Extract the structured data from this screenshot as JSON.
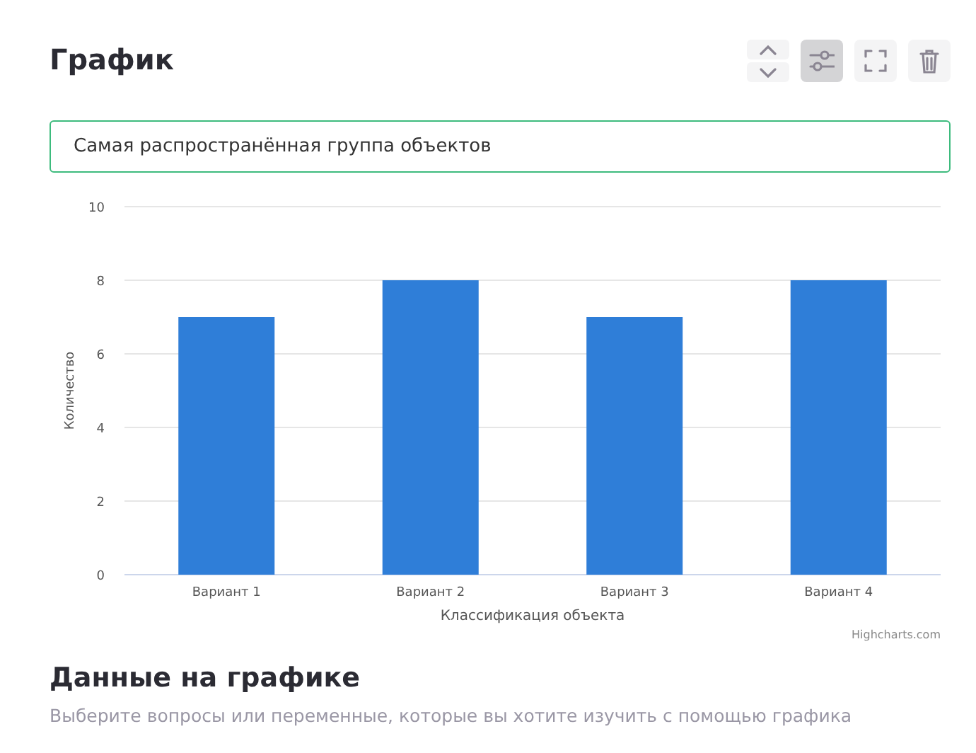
{
  "header": {
    "title": "График"
  },
  "toolbar": [
    {
      "kind": "updown",
      "selected": false
    },
    {
      "kind": "settings",
      "selected": true
    },
    {
      "kind": "fullscreen",
      "selected": false
    },
    {
      "kind": "delete",
      "selected": false
    }
  ],
  "title_field": {
    "value": "Самая распространённая группа объектов"
  },
  "chart_data": {
    "type": "bar",
    "xlabel": "Классификация объекта",
    "ylabel": "Количество",
    "categories": [
      "Вариант 1",
      "Вариант 2",
      "Вариант 3",
      "Вариант 4"
    ],
    "series": [
      {
        "color": "#2f7ed8",
        "values": [
          7,
          8,
          7,
          8
        ]
      }
    ],
    "ylim": [
      0,
      10
    ],
    "yticks": [
      0,
      2,
      4,
      6,
      8,
      10
    ],
    "grid": true
  },
  "chart_credits": "Highcharts.com",
  "data_section": {
    "title": "Данные на графике",
    "subtitle": "Выберите вопросы или переменные, которые вы хотите изучить с помощью графика"
  }
}
